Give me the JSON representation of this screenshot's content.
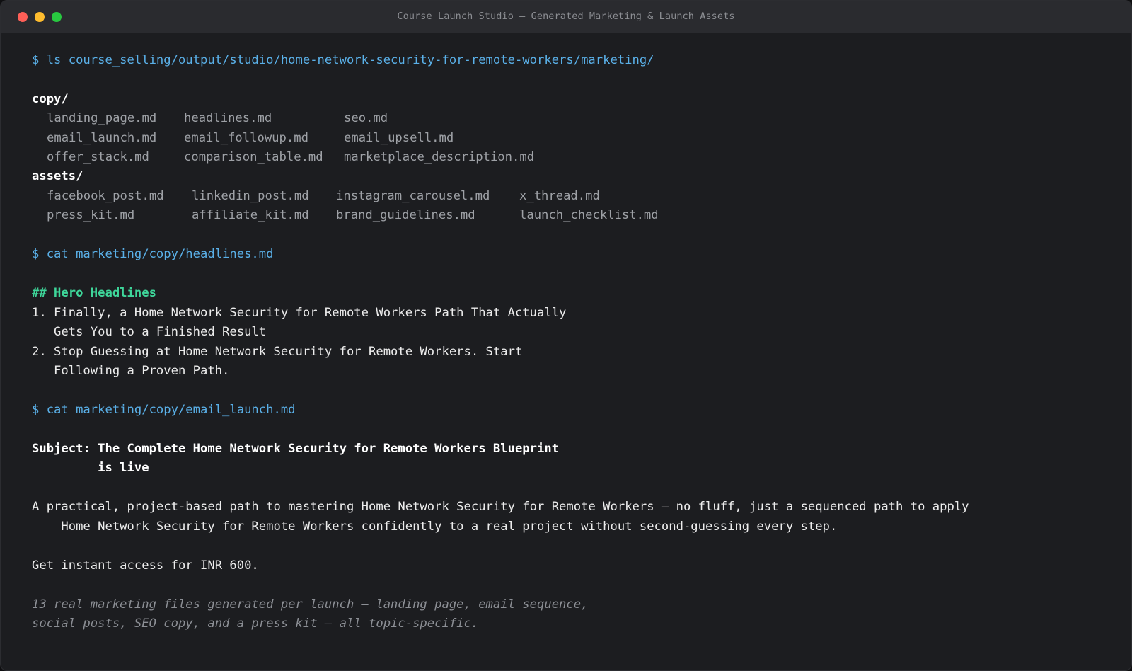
{
  "window": {
    "title": "Course Launch Studio — Generated Marketing & Launch Assets"
  },
  "terminal": {
    "cmd_ls": "$ ls course_selling/output/studio/home-network-security-for-remote-workers/marketing/",
    "copy_dir": "copy/",
    "copy_files": [
      [
        "landing_page.md",
        "headlines.md",
        "seo.md"
      ],
      [
        "email_launch.md",
        "email_followup.md",
        "email_upsell.md"
      ],
      [
        "offer_stack.md",
        "comparison_table.md",
        "marketplace_description.md"
      ]
    ],
    "assets_dir": "assets/",
    "asset_files": [
      [
        "facebook_post.md",
        "linkedin_post.md",
        "instagram_carousel.md",
        "x_thread.md"
      ],
      [
        "press_kit.md",
        "affiliate_kit.md",
        "brand_guidelines.md",
        "launch_checklist.md"
      ]
    ],
    "cmd_cat_headlines": "$ cat marketing/copy/headlines.md",
    "headlines_heading": "## Hero Headlines",
    "headline_lines": [
      "1. Finally, a Home Network Security for Remote Workers Path That Actually",
      "   Gets You to a Finished Result",
      "2. Stop Guessing at Home Network Security for Remote Workers. Start",
      "   Following a Proven Path."
    ],
    "cmd_cat_email": "$ cat marketing/copy/email_launch.md",
    "subject_line1": "Subject: The Complete Home Network Security for Remote Workers Blueprint",
    "subject_line2": "         is live",
    "body_line1": "A practical, project-based path to mastering Home Network Security for Remote Workers — no fluff, just a sequenced path to apply",
    "body_line2": "    Home Network Security for Remote Workers confidently to a real project without second-guessing every step.",
    "cta_line": "Get instant access for INR 600.",
    "note_line1": "13 real marketing files generated per launch — landing page, email sequence,",
    "note_line2": "social posts, SEO copy, and a press kit — all topic-specific."
  }
}
